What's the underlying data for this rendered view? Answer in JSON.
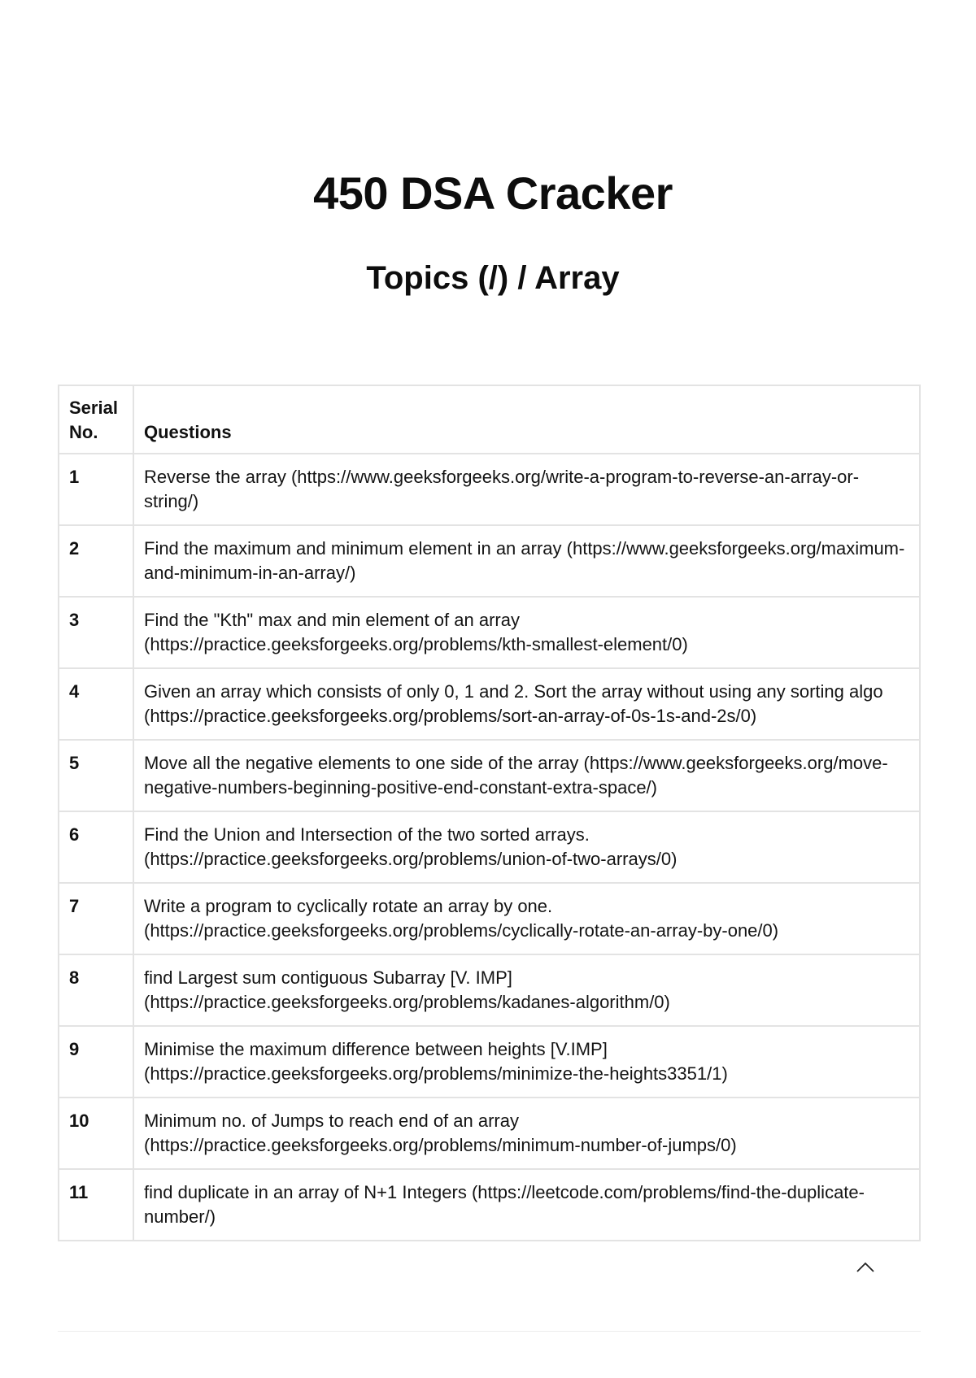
{
  "header": {
    "title": "450 DSA Cracker",
    "subtitle": "Topics (/) / Array"
  },
  "table": {
    "columns": {
      "serial": "Serial No.",
      "questions": "Questions"
    },
    "rows": [
      {
        "serial": "1",
        "question": "Reverse the array (https://www.geeksforgeeks.org/write-a-program-to-reverse-an-array-or-string/)"
      },
      {
        "serial": "2",
        "question": "Find the maximum and minimum element in an array (https://www.geeksforgeeks.org/maximum-and-minimum-in-an-array/)"
      },
      {
        "serial": "3",
        "question": "Find the \"Kth\" max and min element of an array (https://practice.geeksforgeeks.org/problems/kth-smallest-element/0)"
      },
      {
        "serial": "4",
        "question": "Given an array which consists of only 0, 1 and 2. Sort the array without using any sorting algo (https://practice.geeksforgeeks.org/problems/sort-an-array-of-0s-1s-and-2s/0)"
      },
      {
        "serial": "5",
        "question": "Move all the negative elements to one side of the array (https://www.geeksforgeeks.org/move-negative-numbers-beginning-positive-end-constant-extra-space/)"
      },
      {
        "serial": "6",
        "question": "Find the Union and Intersection of the two sorted arrays. (https://practice.geeksforgeeks.org/problems/union-of-two-arrays/0)"
      },
      {
        "serial": "7",
        "question": "Write a program to cyclically rotate an array by one. (https://practice.geeksforgeeks.org/problems/cyclically-rotate-an-array-by-one/0)"
      },
      {
        "serial": "8",
        "question": "find Largest sum contiguous Subarray [V. IMP] (https://practice.geeksforgeeks.org/problems/kadanes-algorithm/0)"
      },
      {
        "serial": "9",
        "question": "Minimise the maximum difference between heights [V.IMP] (https://practice.geeksforgeeks.org/problems/minimize-the-heights3351/1)"
      },
      {
        "serial": "10",
        "question": "Minimum no. of Jumps to reach end of an array (https://practice.geeksforgeeks.org/problems/minimum-number-of-jumps/0)"
      },
      {
        "serial": "11",
        "question": "find duplicate in an array of N+1 Integers (https://leetcode.com/problems/find-the-duplicate-number/)"
      }
    ]
  },
  "icons": {
    "scroll_top": "chevron-up-icon"
  }
}
